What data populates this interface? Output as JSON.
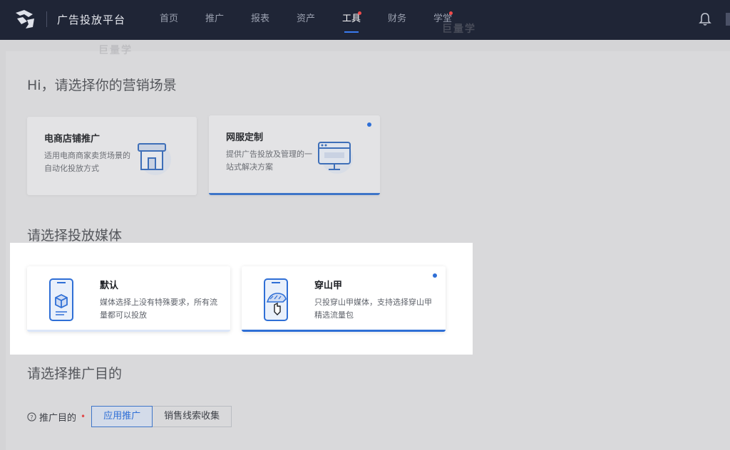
{
  "topbar": {
    "brand": "广告投放平台",
    "nav": [
      {
        "label": "首页",
        "active": false,
        "dot": false
      },
      {
        "label": "推广",
        "active": false,
        "dot": false
      },
      {
        "label": "报表",
        "active": false,
        "dot": false
      },
      {
        "label": "资产",
        "active": false,
        "dot": false
      },
      {
        "label": "工具",
        "active": true,
        "dot": true
      },
      {
        "label": "财务",
        "active": false,
        "dot": false
      },
      {
        "label": "学堂",
        "active": false,
        "dot": true
      }
    ]
  },
  "sections": {
    "scene_title": "Hi，请选择你的营销场景",
    "media_title": "请选择投放媒体",
    "purpose_title": "请选择推广目的"
  },
  "scenes": [
    {
      "title": "电商店铺推广",
      "desc": "适用电商商家卖货场景的自动化投放方式",
      "icon": "storefront-icon"
    },
    {
      "title": "网服定制",
      "desc": "提供广告投放及管理的一站式解决方案",
      "icon": "monitor-icon",
      "selected": true
    }
  ],
  "media": [
    {
      "title": "默认",
      "desc": "媒体选择上没有特殊要求，所有流量都可以投放",
      "icon": "phone-box-icon"
    },
    {
      "title": "穿山甲",
      "desc": "只投穿山甲媒体，支持选择穿山甲精选流量包",
      "icon": "phone-pangolin-icon",
      "selected": true
    }
  ],
  "purpose": {
    "label": "推广目的",
    "required_mark": "•",
    "options": [
      "应用推广",
      "销售线索收集"
    ],
    "selected": "应用推广"
  },
  "watermark": "巨量学",
  "colors": {
    "topbar_bg": "#1f2536",
    "accent": "#2f6fd6",
    "nav_dot": "#f04b4b"
  }
}
